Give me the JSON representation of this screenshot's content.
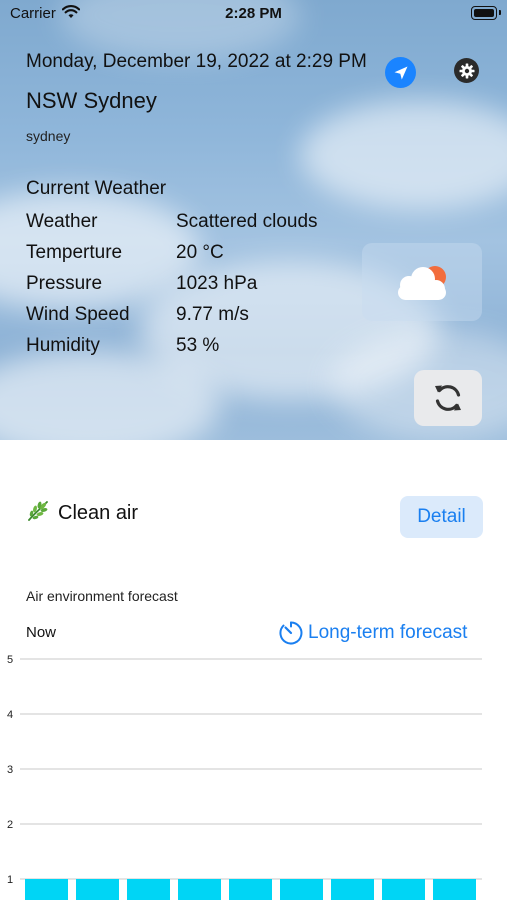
{
  "status_bar": {
    "carrier": "Carrier",
    "time": "2:28 PM"
  },
  "header": {
    "datetime": "Monday, December 19, 2022 at 2:29 PM",
    "city": "NSW Sydney",
    "city_sub": "sydney"
  },
  "current": {
    "title": "Current Weather",
    "rows": [
      {
        "label": "Weather",
        "value": "Scattered clouds"
      },
      {
        "label": "Temperture",
        "value": "20 °C"
      },
      {
        "label": "Pressure",
        "value": "1023 hPa"
      },
      {
        "label": "Wind Speed",
        "value": "9.77 m/s"
      },
      {
        "label": "Humidity",
        "value": "53 %"
      }
    ],
    "icon": "cloud-sun-icon"
  },
  "air": {
    "status": "Clean air",
    "detail_label": "Detail"
  },
  "forecast": {
    "title": "Air environment forecast",
    "now_label": "Now",
    "long_term_label": "Long-term forecast"
  },
  "colors": {
    "accent": "#1a7ff0",
    "bar": "#00d5f5",
    "location_button": "#1a84ff"
  },
  "chart_data": {
    "type": "bar",
    "yticks": [
      1,
      2,
      3,
      4,
      5
    ],
    "ylim": [
      0.6,
      5
    ],
    "values": [
      1,
      1,
      1,
      1,
      1,
      1,
      1,
      1,
      1
    ],
    "grid": true
  }
}
